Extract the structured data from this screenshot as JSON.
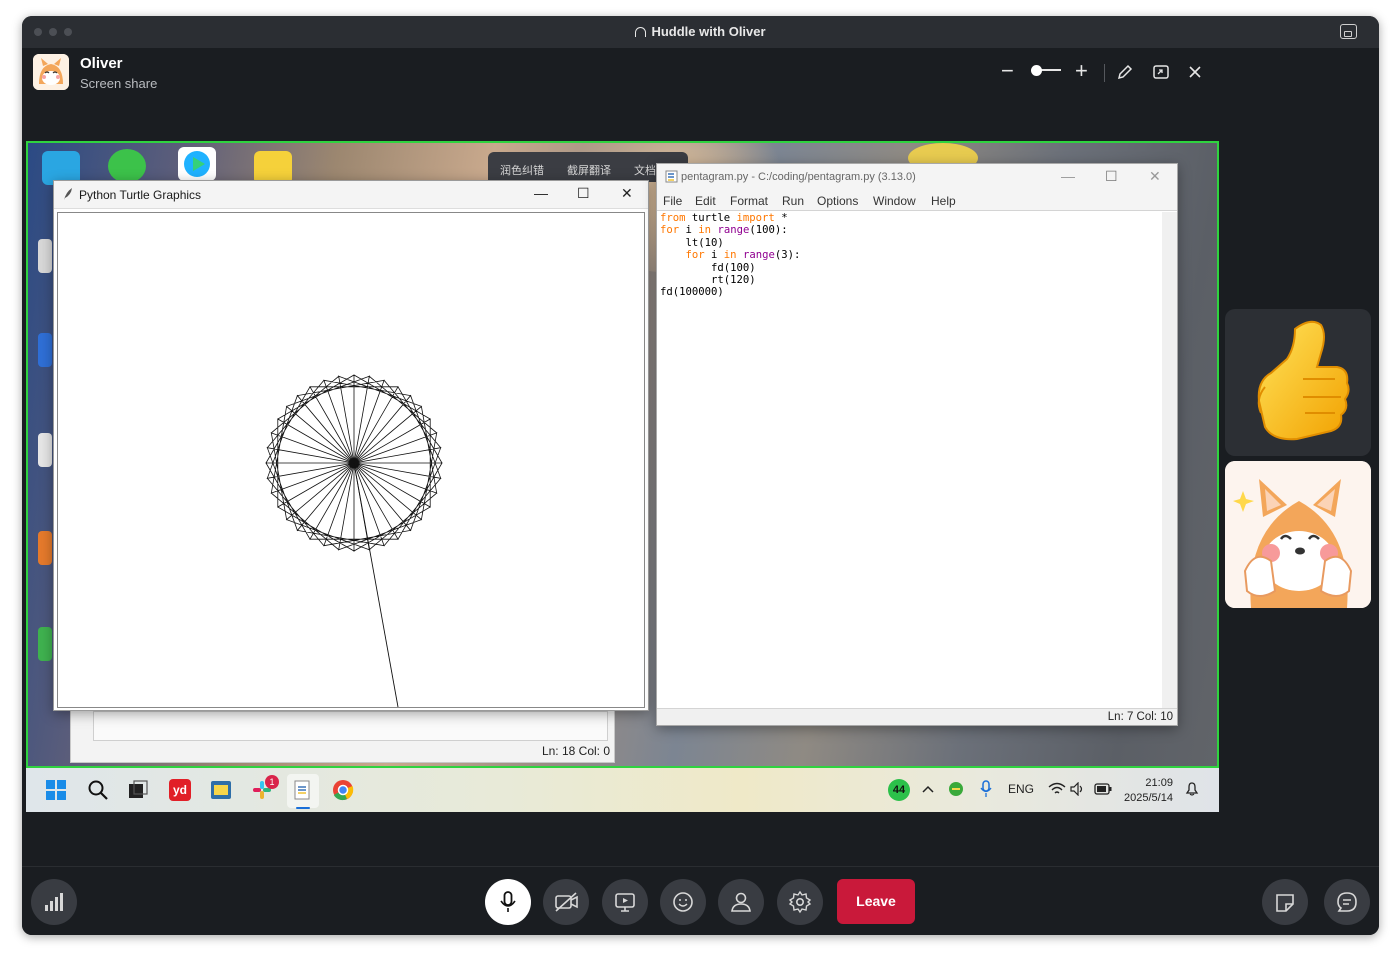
{
  "window": {
    "title": "Huddle with Oliver",
    "presenter_name": "Oliver",
    "presenter_status": "Screen share"
  },
  "header_controls": {
    "zoom_out_label": "−",
    "zoom_in_label": "+",
    "zoom_level": 0.25
  },
  "shared_screen": {
    "turtle_window": {
      "title": "Python Turtle Graphics",
      "minimize": "—",
      "maximize": "☐",
      "close": "✕"
    },
    "behind_window": {
      "status": "Ln: 18  Col: 0"
    },
    "browser_tabs": [
      "润色纠错",
      "截屏翻译",
      "文档"
    ],
    "idle_window": {
      "title": "pentagram.py - C:/coding/pentagram.py (3.13.0)",
      "menu": [
        "File",
        "Edit",
        "Format",
        "Run",
        "Options",
        "Window",
        "Help"
      ],
      "code_lines": [
        [
          {
            "t": "from",
            "c": "kw"
          },
          {
            "t": " turtle "
          },
          {
            "t": "import",
            "c": "kw"
          },
          {
            "t": " *"
          }
        ],
        [
          {
            "t": "for",
            "c": "kw"
          },
          {
            "t": " i "
          },
          {
            "t": "in",
            "c": "kw"
          },
          {
            "t": " "
          },
          {
            "t": "range",
            "c": "bi"
          },
          {
            "t": "(100):"
          }
        ],
        [
          {
            "t": "    lt(10)"
          }
        ],
        [
          {
            "t": "    "
          },
          {
            "t": "for",
            "c": "kw"
          },
          {
            "t": " i "
          },
          {
            "t": "in",
            "c": "kw"
          },
          {
            "t": " "
          },
          {
            "t": "range",
            "c": "bi"
          },
          {
            "t": "(3):"
          }
        ],
        [
          {
            "t": "        fd(100)"
          }
        ],
        [
          {
            "t": "        rt(120)"
          }
        ],
        [
          {
            "t": "fd(100000)"
          }
        ]
      ],
      "status": "Ln: 7   Col: 10"
    },
    "taskbar": {
      "badge_count": "1",
      "tray_badge": "44",
      "language": "ENG",
      "time": "21:09",
      "date": "2025/5/14"
    }
  },
  "reactions": [
    "thumbs-up",
    "shiba-dog"
  ],
  "bottom_controls": {
    "leave_label": "Leave",
    "buttons": [
      "signal-icon",
      "mic-icon",
      "camera-off-icon",
      "screen-share-icon",
      "emoji-icon",
      "people-icon",
      "settings-icon",
      "sticker-icon",
      "chat-icon"
    ]
  },
  "colors": {
    "leave": "#c9193a",
    "share_border": "#2fd33f",
    "background": "#1a1d21"
  }
}
